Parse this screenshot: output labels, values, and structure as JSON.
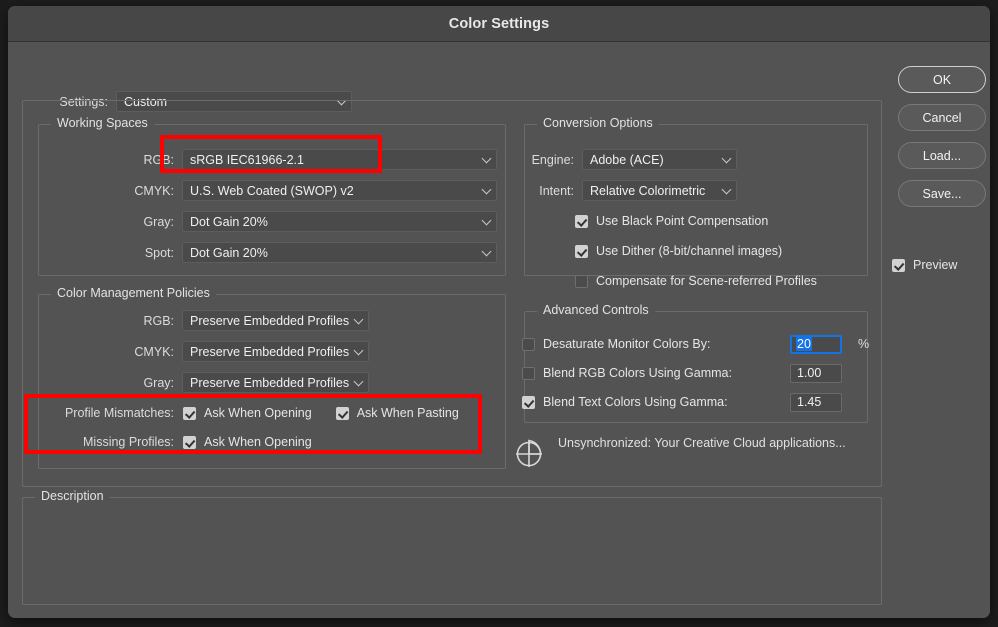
{
  "window": {
    "title": "Color Settings"
  },
  "settings_row": {
    "label": "Settings:",
    "value": "Custom"
  },
  "working_spaces": {
    "legend": "Working Spaces",
    "rows": [
      {
        "label": "RGB:",
        "value": "sRGB IEC61966-2.1"
      },
      {
        "label": "CMYK:",
        "value": "U.S. Web Coated (SWOP) v2"
      },
      {
        "label": "Gray:",
        "value": "Dot Gain 20%"
      },
      {
        "label": "Spot:",
        "value": "Dot Gain 20%"
      }
    ]
  },
  "color_management_policies": {
    "legend": "Color Management Policies",
    "rows": [
      {
        "label": "RGB:",
        "value": "Preserve Embedded Profiles"
      },
      {
        "label": "CMYK:",
        "value": "Preserve Embedded Profiles"
      },
      {
        "label": "Gray:",
        "value": "Preserve Embedded Profiles"
      }
    ],
    "profile_mismatches": {
      "label": "Profile Mismatches:",
      "ask_when_opening": "Ask When Opening",
      "ask_when_opening_checked": true,
      "ask_when_pasting": "Ask When Pasting",
      "ask_when_pasting_checked": true
    },
    "missing_profiles": {
      "label": "Missing Profiles:",
      "ask_when_opening": "Ask When Opening",
      "ask_when_opening_checked": true
    }
  },
  "conversion_options": {
    "legend": "Conversion Options",
    "engine": {
      "label": "Engine:",
      "value": "Adobe (ACE)"
    },
    "intent": {
      "label": "Intent:",
      "value": "Relative Colorimetric"
    },
    "checkboxes": [
      {
        "label": "Use Black Point Compensation",
        "checked": true
      },
      {
        "label": "Use Dither (8-bit/channel images)",
        "checked": true
      },
      {
        "label": "Compensate for Scene-referred Profiles",
        "checked": false
      }
    ]
  },
  "advanced_controls": {
    "legend": "Advanced Controls",
    "rows": [
      {
        "label": "Desaturate Monitor Colors By:",
        "checked": false,
        "value": "20",
        "unit": "%",
        "focused": true
      },
      {
        "label": "Blend RGB Colors Using Gamma:",
        "checked": false,
        "value": "1.00",
        "unit": "",
        "focused": false
      },
      {
        "label": "Blend Text Colors Using Gamma:",
        "checked": true,
        "value": "1.45",
        "unit": "",
        "focused": false
      }
    ]
  },
  "sync_status": {
    "icon": "cloud-sync-icon",
    "text": "Unsynchronized: Your Creative Cloud applications..."
  },
  "description": {
    "legend": "Description",
    "text": ""
  },
  "buttons": [
    {
      "label": "OK",
      "default": true
    },
    {
      "label": "Cancel",
      "default": false
    },
    {
      "label": "Load...",
      "default": false
    },
    {
      "label": "Save...",
      "default": false
    }
  ],
  "preview": {
    "label": "Preview",
    "checked": true
  },
  "annotations": {
    "accent_color": "#ff0000",
    "highlight_rgb_field": true,
    "highlight_profile_policies": true
  }
}
